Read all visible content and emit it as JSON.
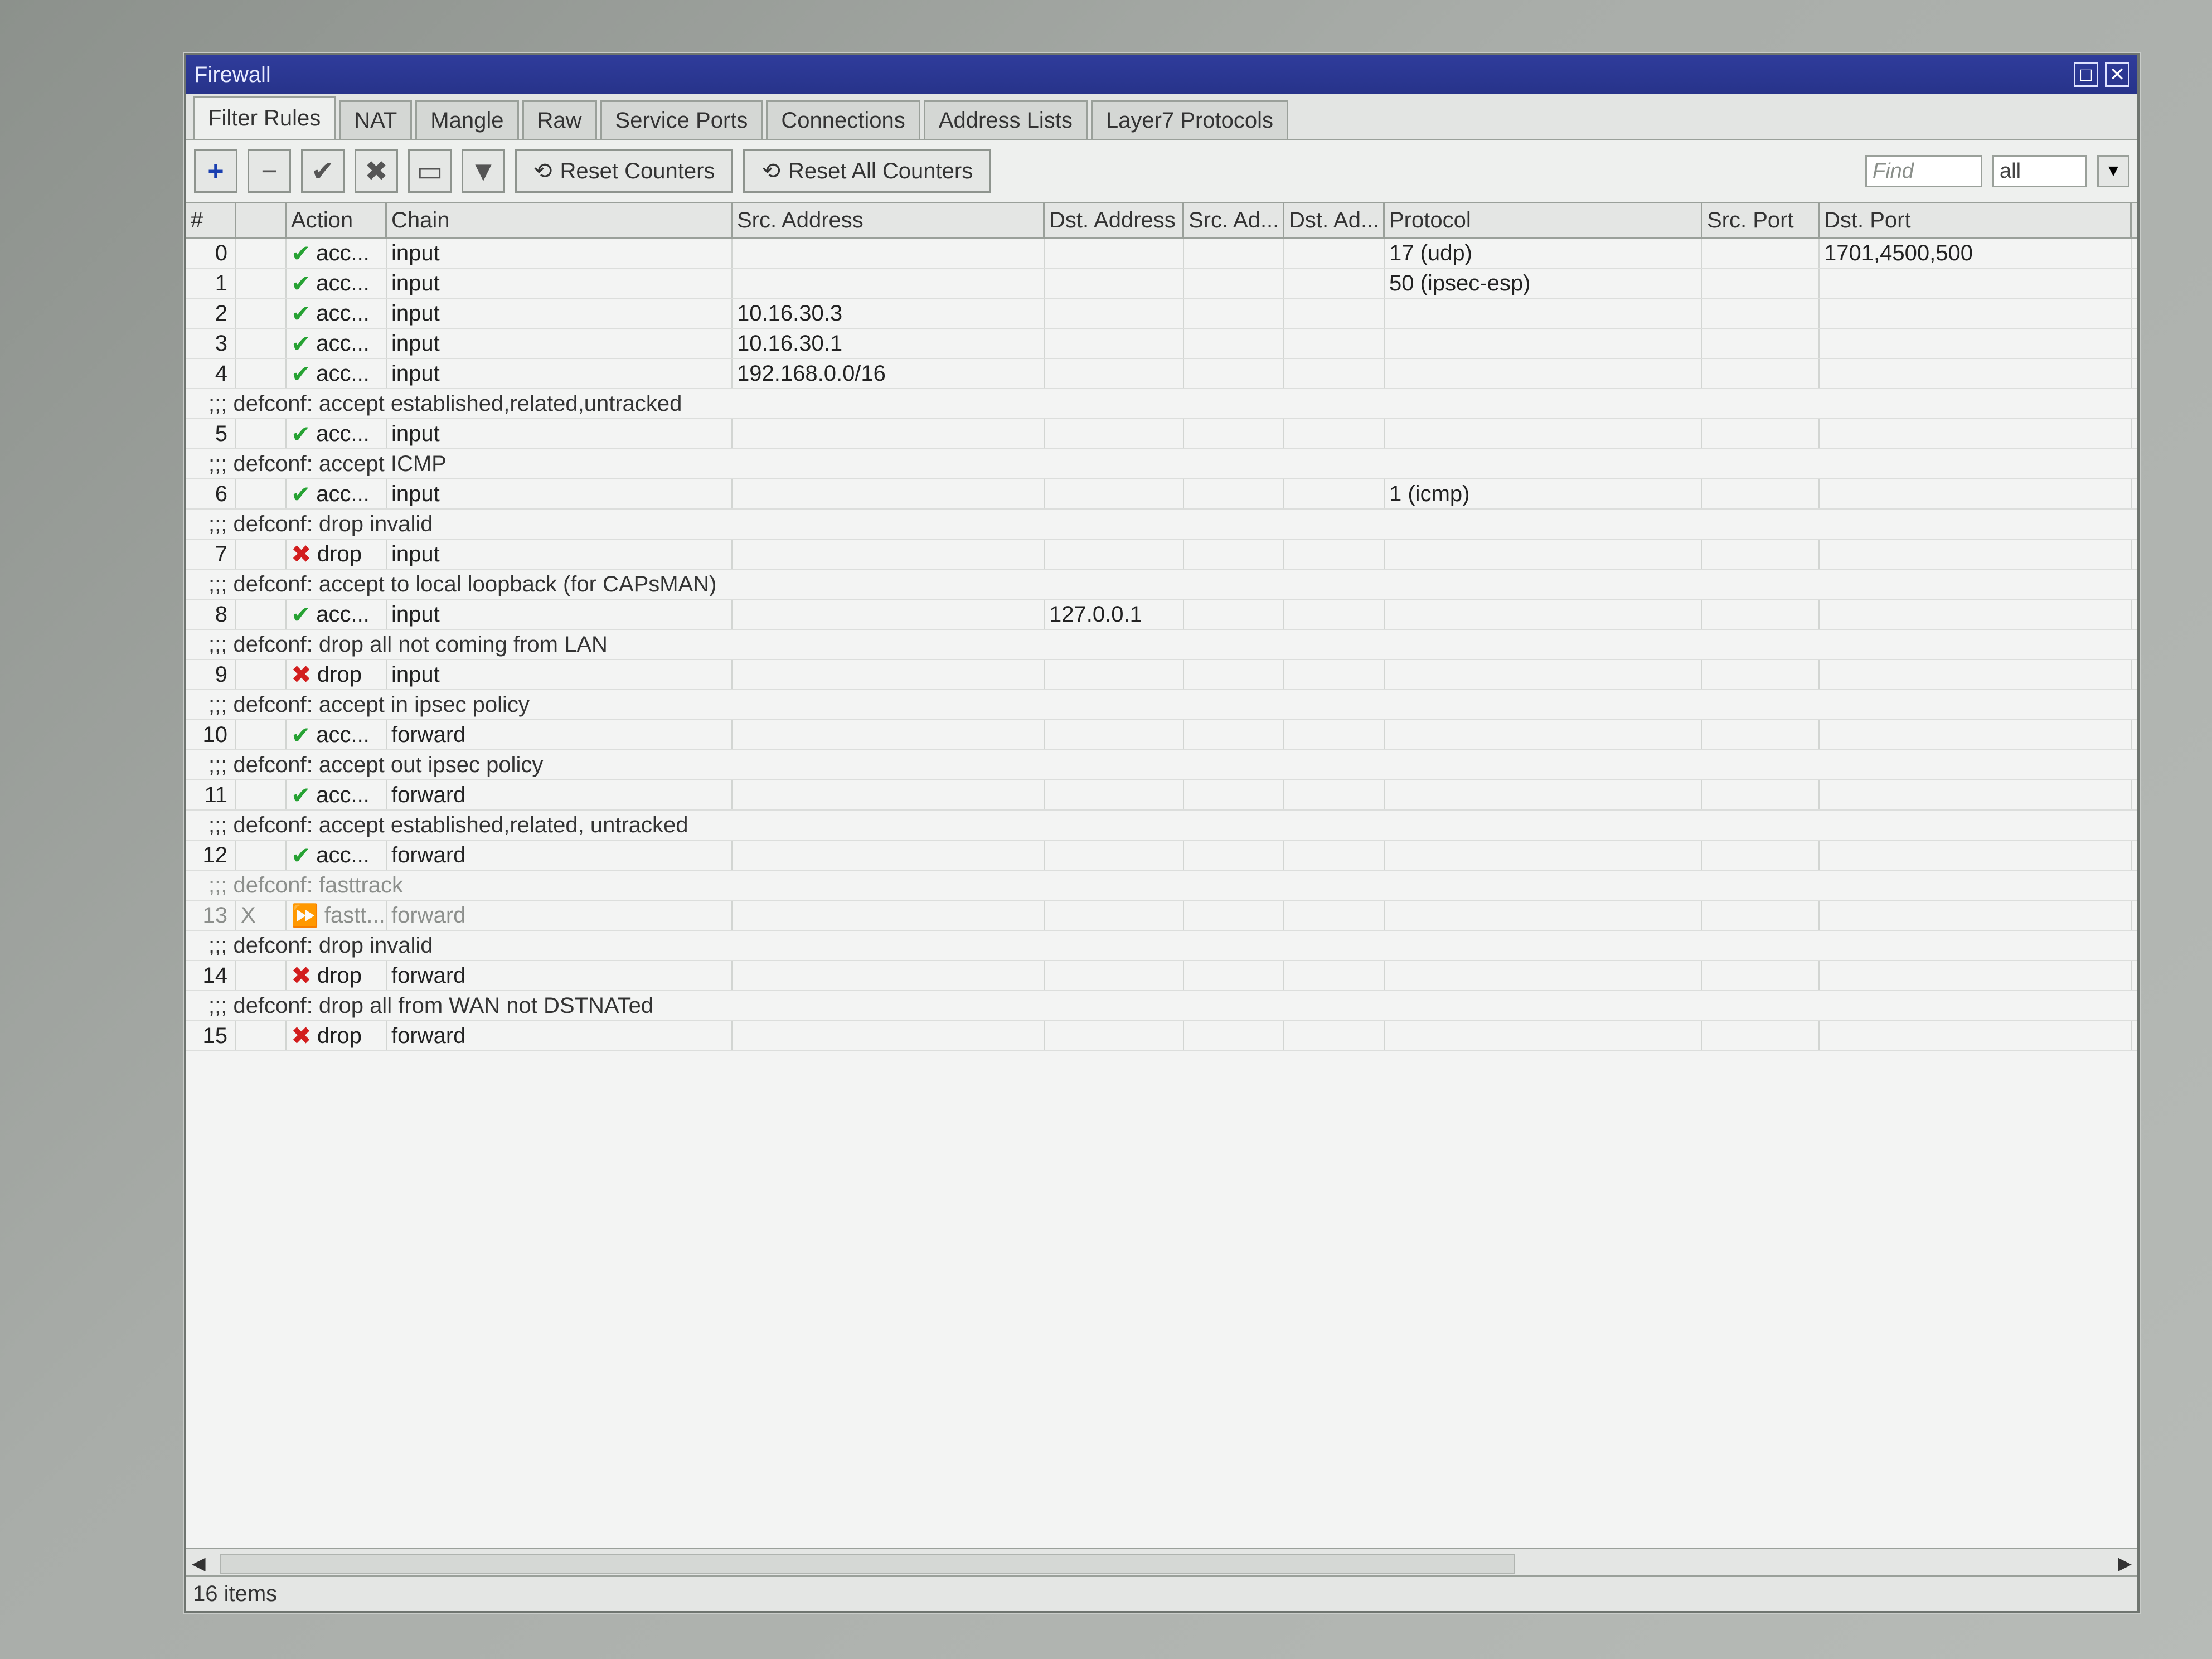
{
  "window": {
    "title": "Firewall"
  },
  "tabs": [
    "Filter Rules",
    "NAT",
    "Mangle",
    "Raw",
    "Service Ports",
    "Connections",
    "Address Lists",
    "Layer7 Protocols"
  ],
  "toolbar": {
    "reset_counters": "Reset Counters",
    "reset_all_counters": "Reset All Counters",
    "find_placeholder": "Find",
    "filter_value": "all"
  },
  "columns": [
    "#",
    "",
    "Action",
    "Chain",
    "Src. Address",
    "Dst. Address",
    "Src. Ad...",
    "Dst. Ad...",
    "Protocol",
    "Src. Port",
    "Dst. Port"
  ],
  "rows": [
    {
      "type": "rule",
      "num": "0",
      "flag": "",
      "action": "acc...",
      "kind": "accept",
      "chain": "input",
      "src": "",
      "dst": "",
      "protocol": "17 (udp)",
      "sport": "",
      "dport": "1701,4500,500"
    },
    {
      "type": "rule",
      "num": "1",
      "flag": "",
      "action": "acc...",
      "kind": "accept",
      "chain": "input",
      "src": "",
      "dst": "",
      "protocol": "50 (ipsec-esp)",
      "sport": "",
      "dport": ""
    },
    {
      "type": "rule",
      "num": "2",
      "flag": "",
      "action": "acc...",
      "kind": "accept",
      "chain": "input",
      "src": "10.16.30.3",
      "dst": "",
      "protocol": "",
      "sport": "",
      "dport": ""
    },
    {
      "type": "rule",
      "num": "3",
      "flag": "",
      "action": "acc...",
      "kind": "accept",
      "chain": "input",
      "src": "10.16.30.1",
      "dst": "",
      "protocol": "",
      "sport": "",
      "dport": ""
    },
    {
      "type": "rule",
      "num": "4",
      "flag": "",
      "action": "acc...",
      "kind": "accept",
      "chain": "input",
      "src": "192.168.0.0/16",
      "dst": "",
      "protocol": "",
      "sport": "",
      "dport": ""
    },
    {
      "type": "comment",
      "text": ";;; defconf: accept established,related,untracked"
    },
    {
      "type": "rule",
      "num": "5",
      "flag": "",
      "action": "acc...",
      "kind": "accept",
      "chain": "input",
      "src": "",
      "dst": "",
      "protocol": "",
      "sport": "",
      "dport": ""
    },
    {
      "type": "comment",
      "text": ";;; defconf: accept ICMP"
    },
    {
      "type": "rule",
      "num": "6",
      "flag": "",
      "action": "acc...",
      "kind": "accept",
      "chain": "input",
      "src": "",
      "dst": "",
      "protocol": "1 (icmp)",
      "sport": "",
      "dport": ""
    },
    {
      "type": "comment",
      "text": ";;; defconf: drop invalid"
    },
    {
      "type": "rule",
      "num": "7",
      "flag": "",
      "action": "drop",
      "kind": "drop",
      "chain": "input",
      "src": "",
      "dst": "",
      "protocol": "",
      "sport": "",
      "dport": ""
    },
    {
      "type": "comment",
      "text": ";;; defconf: accept to local loopback (for CAPsMAN)"
    },
    {
      "type": "rule",
      "num": "8",
      "flag": "",
      "action": "acc...",
      "kind": "accept",
      "chain": "input",
      "src": "",
      "dst": "127.0.0.1",
      "protocol": "",
      "sport": "",
      "dport": ""
    },
    {
      "type": "comment",
      "text": ";;; defconf: drop all not coming from LAN"
    },
    {
      "type": "rule",
      "num": "9",
      "flag": "",
      "action": "drop",
      "kind": "drop",
      "chain": "input",
      "src": "",
      "dst": "",
      "protocol": "",
      "sport": "",
      "dport": ""
    },
    {
      "type": "comment",
      "text": ";;; defconf: accept in ipsec policy"
    },
    {
      "type": "rule",
      "num": "10",
      "flag": "",
      "action": "acc...",
      "kind": "accept",
      "chain": "forward",
      "src": "",
      "dst": "",
      "protocol": "",
      "sport": "",
      "dport": ""
    },
    {
      "type": "comment",
      "text": ";;; defconf: accept out ipsec policy"
    },
    {
      "type": "rule",
      "num": "11",
      "flag": "",
      "action": "acc...",
      "kind": "accept",
      "chain": "forward",
      "src": "",
      "dst": "",
      "protocol": "",
      "sport": "",
      "dport": ""
    },
    {
      "type": "comment",
      "text": ";;; defconf: accept established,related, untracked"
    },
    {
      "type": "rule",
      "num": "12",
      "flag": "",
      "action": "acc...",
      "kind": "accept",
      "chain": "forward",
      "src": "",
      "dst": "",
      "protocol": "",
      "sport": "",
      "dport": ""
    },
    {
      "type": "comment",
      "text": ";;; defconf: fasttrack",
      "disabled": true
    },
    {
      "type": "rule",
      "num": "13",
      "flag": "X",
      "action": "fastt...",
      "kind": "fasttrack",
      "chain": "forward",
      "src": "",
      "dst": "",
      "protocol": "",
      "sport": "",
      "dport": "",
      "disabled": true
    },
    {
      "type": "comment",
      "text": ";;; defconf: drop invalid"
    },
    {
      "type": "rule",
      "num": "14",
      "flag": "",
      "action": "drop",
      "kind": "drop",
      "chain": "forward",
      "src": "",
      "dst": "",
      "protocol": "",
      "sport": "",
      "dport": ""
    },
    {
      "type": "comment",
      "text": ";;; defconf: drop all from WAN not DSTNATed"
    },
    {
      "type": "rule",
      "num": "15",
      "flag": "",
      "action": "drop",
      "kind": "drop",
      "chain": "forward",
      "src": "",
      "dst": "",
      "protocol": "",
      "sport": "",
      "dport": ""
    }
  ],
  "status": {
    "items": "16 items"
  }
}
